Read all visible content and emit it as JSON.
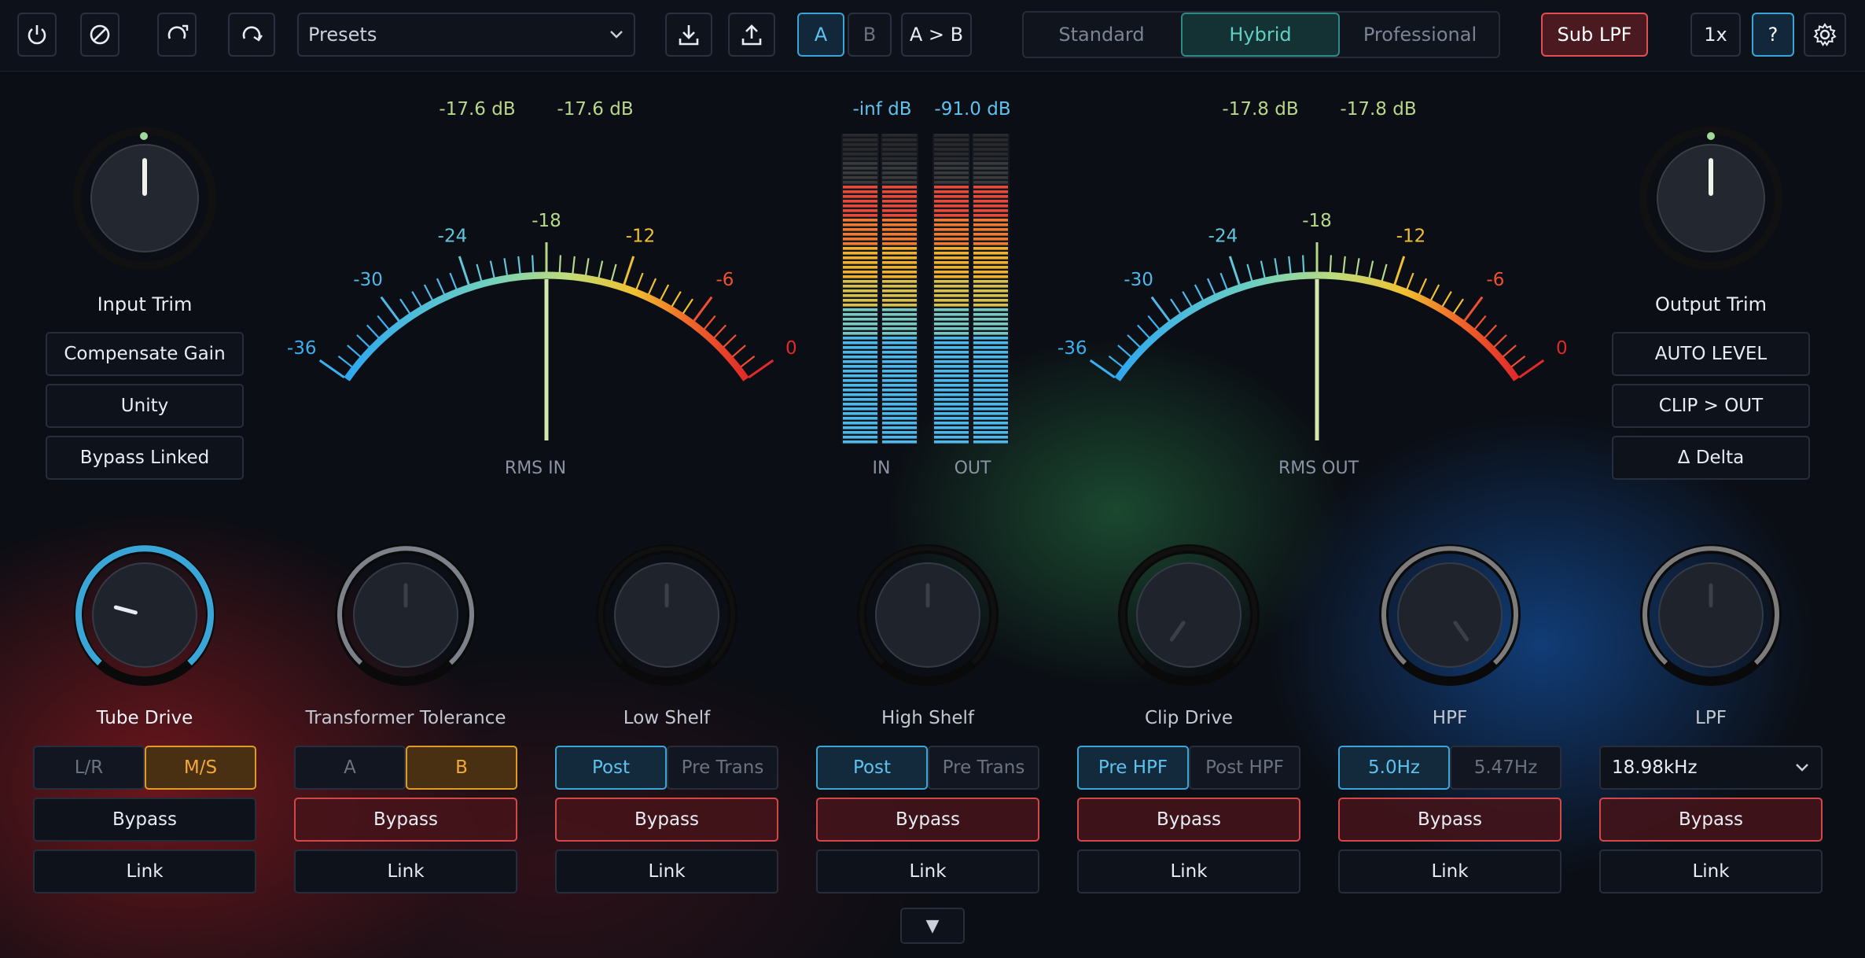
{
  "header": {
    "presets_label": "Presets",
    "ab": {
      "a": "A",
      "b": "B",
      "copy": "A > B"
    },
    "modes": [
      "Standard",
      "Hybrid",
      "Professional"
    ],
    "active_mode": "Hybrid",
    "sub_lpf": "Sub LPF",
    "zoom": "1x",
    "help": "?"
  },
  "input": {
    "knob_label": "Input Trim",
    "buttons": [
      "Compensate Gain",
      "Unity",
      "Bypass Linked"
    ]
  },
  "output": {
    "knob_label": "Output Trim",
    "buttons": [
      "AUTO LEVEL",
      "CLIP > OUT",
      "Δ Delta"
    ]
  },
  "vu_in": {
    "label": "RMS IN",
    "readout_l": "-17.6 dB",
    "readout_r": "-17.6 dB",
    "scale": [
      "-36",
      "-30",
      "-24",
      "-18",
      "-12",
      "-6",
      "0"
    ]
  },
  "vu_out": {
    "label": "RMS OUT",
    "readout_l": "-17.8 dB",
    "readout_r": "-17.8 dB",
    "scale": [
      "-36",
      "-30",
      "-24",
      "-18",
      "-12",
      "-6",
      "0"
    ]
  },
  "peak": {
    "in_readout": "-inf dB",
    "out_readout": "-91.0 dB",
    "in_label": "IN",
    "out_label": "OUT"
  },
  "bottom": {
    "bypass": "Bypass",
    "link": "Link",
    "modules": [
      {
        "name": "Tube Drive",
        "opts": [
          "L/R",
          "M/S"
        ],
        "selected": 1,
        "sel_color": "orange",
        "bypass_active": false
      },
      {
        "name": "Transformer Tolerance",
        "opts": [
          "A",
          "B"
        ],
        "selected": 1,
        "sel_color": "orange",
        "bypass_active": true
      },
      {
        "name": "Low Shelf",
        "opts": [
          "Post",
          "Pre Trans"
        ],
        "selected": 0,
        "sel_color": "blue",
        "bypass_active": true
      },
      {
        "name": "High Shelf",
        "opts": [
          "Post",
          "Pre Trans"
        ],
        "selected": 0,
        "sel_color": "blue",
        "bypass_active": true
      },
      {
        "name": "Clip Drive",
        "opts": [
          "Pre HPF",
          "Post HPF"
        ],
        "selected": 0,
        "sel_color": "blue",
        "bypass_active": true
      },
      {
        "name": "HPF",
        "opts": [
          "5.0Hz",
          "5.47Hz"
        ],
        "selected": 0,
        "sel_color": "blue",
        "bypass_active": true
      },
      {
        "name": "LPF",
        "dropdown": "18.98kHz",
        "bypass_active": true
      }
    ],
    "expand_icon": "▼"
  },
  "colors": {
    "accent_blue": "#5ec2f0",
    "bypass_red": "#d24848",
    "orange": "#f3a83a",
    "teal": "#5fd0c4"
  }
}
